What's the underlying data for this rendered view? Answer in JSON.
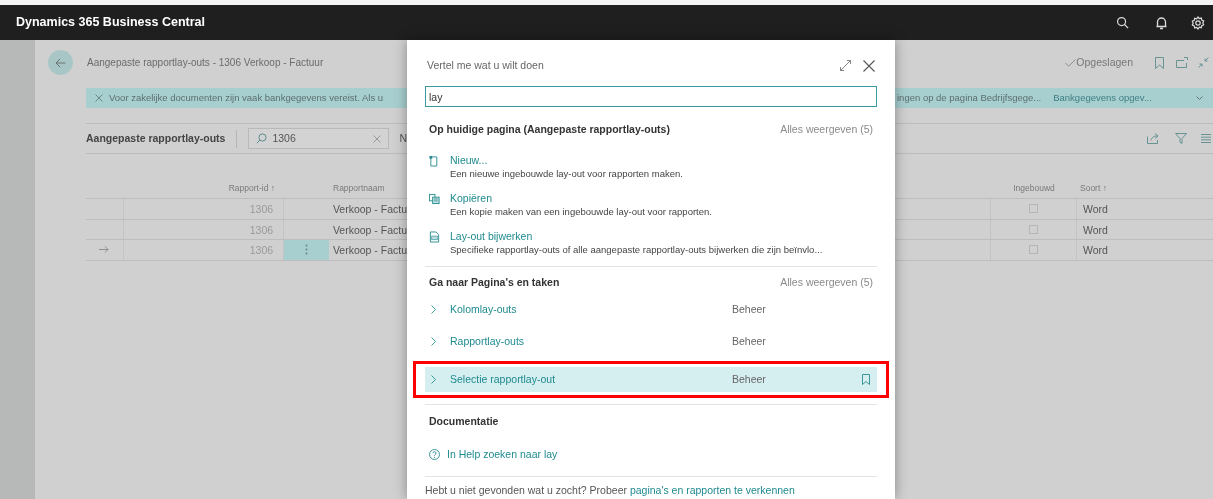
{
  "app_bar": {
    "title": "Dynamics 365 Business Central"
  },
  "page": {
    "breadcrumb": "Aangepaste rapportlay-outs - 1306 Verkoop - Factuur",
    "saved_status": "Opgeslagen"
  },
  "notification": {
    "text_left": "Voor zakelijke documenten zijn vaak bankgegevens vereist. Als u",
    "text_right": "ingen op de pagina Bedrijfsgege...",
    "action": "Bankgegevens opgev..."
  },
  "list": {
    "title": "Aangepaste rapportlay-outs",
    "search_value": "1306",
    "cut_action": "N"
  },
  "table": {
    "columns_left": [
      "Rapport-id ↑",
      "Rapportnaam"
    ],
    "columns_right": [
      "Ingebouwd",
      "Soort ↑"
    ],
    "rows": [
      {
        "current": false,
        "report_id": "1306",
        "report_name": "Verkoop - Factu",
        "built_in": false,
        "type": "Word"
      },
      {
        "current": false,
        "report_id": "1306",
        "report_name": "Verkoop - Factu",
        "built_in": false,
        "type": "Word"
      },
      {
        "current": true,
        "report_id": "1306",
        "report_name": "Verkoop - Factu",
        "built_in": false,
        "type": "Word"
      }
    ]
  },
  "dialog": {
    "title": "Vertel me wat u wilt doen",
    "search_value": "lay",
    "sections": [
      {
        "kind": "actions",
        "heading": "Op huidige pagina (Aangepaste rapportlay-outs)",
        "show_all": "Alles weergeven (5)",
        "items": [
          {
            "kind": "new",
            "title": "Nieuw...",
            "description": "Een nieuwe ingebouwde lay-out voor rapporten maken."
          },
          {
            "kind": "copy",
            "title": "Kopiëren",
            "description": "Een kopie maken van een ingebouwde lay-out voor rapporten."
          },
          {
            "kind": "update",
            "title": "Lay-out bijwerken",
            "description": "Specifieke rapportlay-outs of alle aangepaste rapportlay-outs bijwerken die zijn beïnvlo..."
          }
        ]
      },
      {
        "kind": "pages",
        "heading": "Ga naar Pagina's en taken",
        "show_all": "Alles weergeven (5)",
        "items": [
          {
            "title": "Kolomlay-outs",
            "category": "Beheer",
            "selected": false,
            "annotated": false
          },
          {
            "title": "Rapportlay-outs",
            "category": "Beheer",
            "selected": false,
            "annotated": false
          },
          {
            "title": "Selectie rapportlay-out",
            "category": "Beheer",
            "selected": true,
            "annotated": true
          }
        ]
      },
      {
        "kind": "docs",
        "heading": "Documentatie",
        "items": [
          {
            "title": "In Help zoeken naar lay"
          }
        ]
      }
    ],
    "footer": {
      "text": "Hebt u niet gevonden wat u zocht? Probeer",
      "link": "pagina's en rapporten te verkennen"
    }
  }
}
